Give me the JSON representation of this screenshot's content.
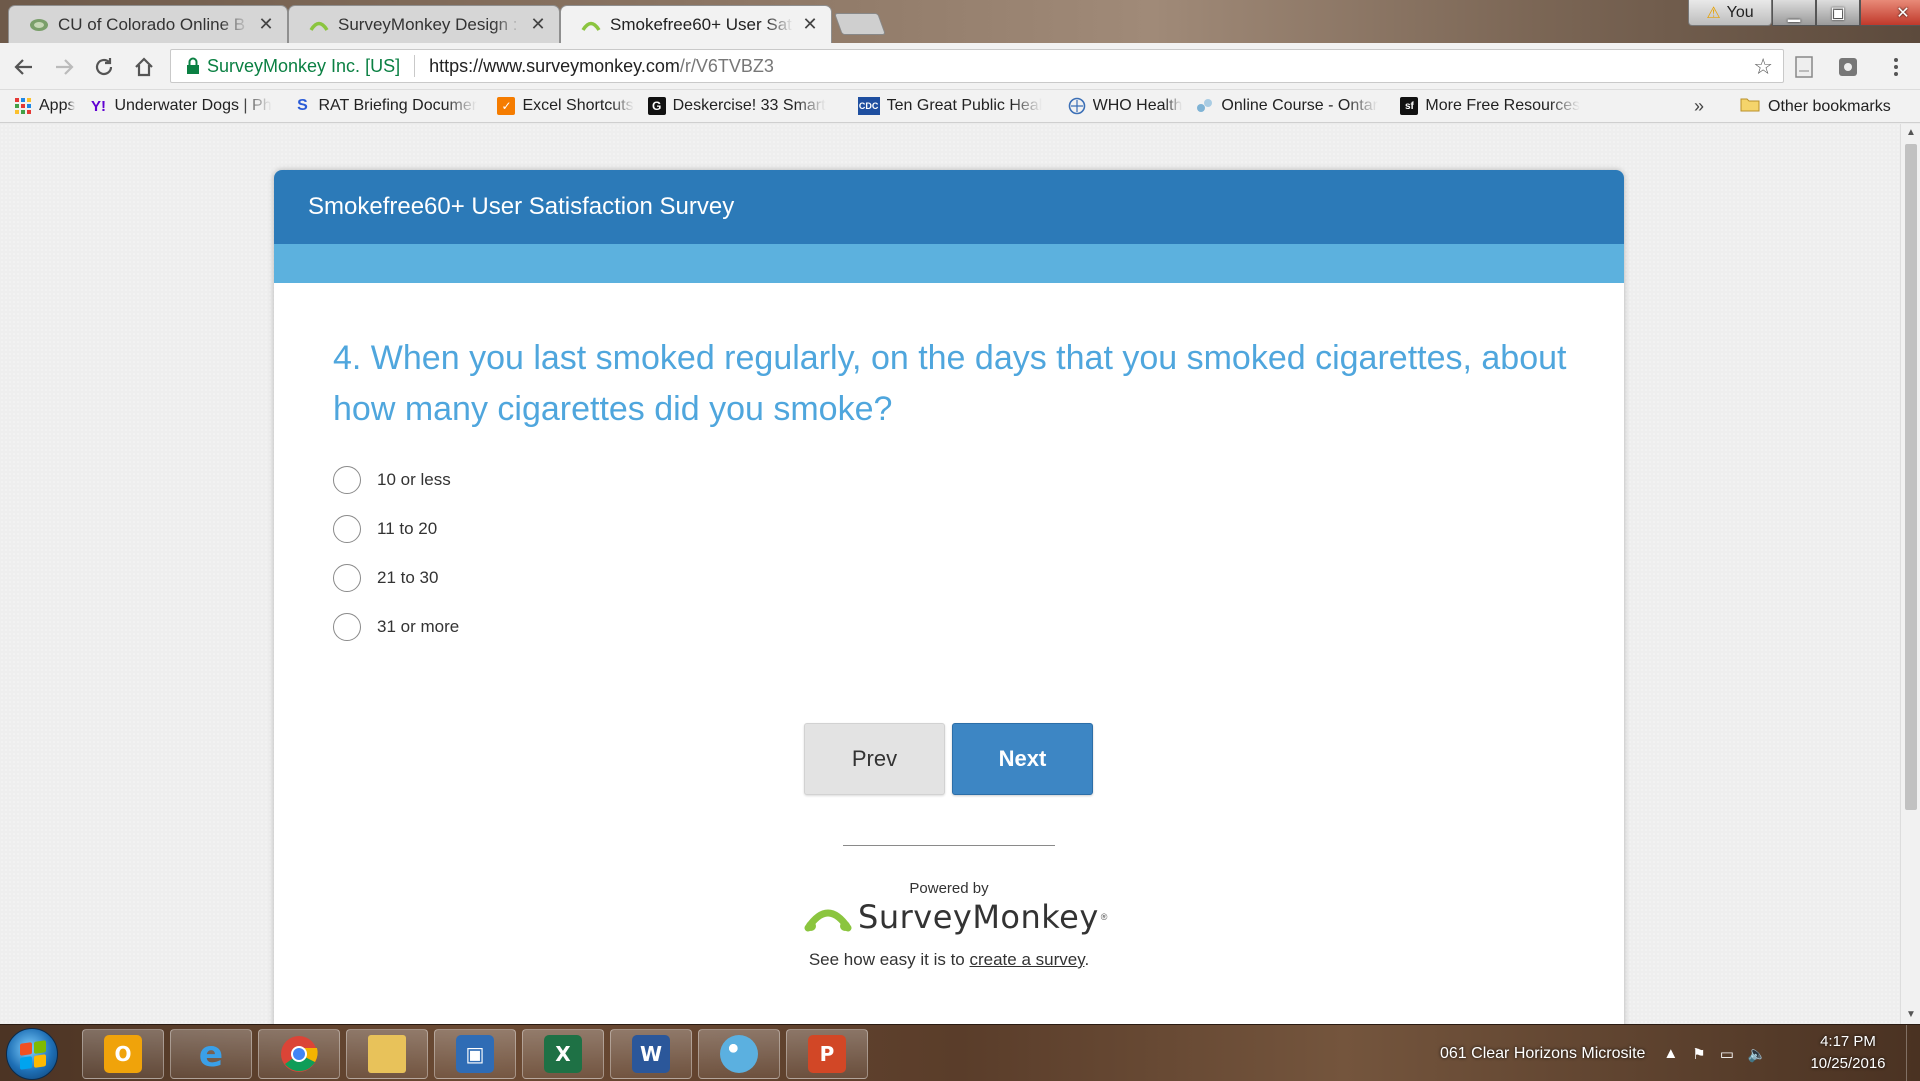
{
  "browser": {
    "tabs": [
      {
        "title": "CU of Colorado Online B",
        "close": "✕"
      },
      {
        "title": "SurveyMonkey Design : S",
        "close": "✕"
      },
      {
        "title": "Smokefree60+ User Satis",
        "close": "✕"
      }
    ],
    "profile_label": "You",
    "window_controls": {
      "minimize": "▁",
      "maximize": "▣",
      "close": "✕"
    },
    "address": {
      "secure_label": "SurveyMonkey Inc. [US]",
      "url_host": "https://www.surveymonkey.com",
      "url_path": "/r/V6TVBZ3"
    },
    "bookmarks": [
      {
        "label": "Apps",
        "icon": "apps-grid-icon"
      },
      {
        "label": "Underwater Dogs | Ph",
        "icon": "yahoo-icon"
      },
      {
        "label": "RAT Briefing Documer",
        "icon": "s-logo-icon"
      },
      {
        "label": "Excel Shortcuts",
        "icon": "orange-page-icon"
      },
      {
        "label": "Deskercise! 33 Smart",
        "icon": "g-logo-icon"
      },
      {
        "label": "Ten Great Public Heal",
        "icon": "cdc-icon"
      },
      {
        "label": "WHO Health",
        "icon": "who-icon"
      },
      {
        "label": "Online Course - Ontar",
        "icon": "course-icon"
      },
      {
        "label": "More Free Resources",
        "icon": "sf-icon"
      }
    ],
    "bookmarks_overflow": "»",
    "other_bookmarks": "Other bookmarks"
  },
  "survey": {
    "title": "Smokefree60+ User Satisfaction Survey",
    "question": "4. When you last smoked regularly, on the days that you smoked cigarettes, about how many cigarettes did you smoke?",
    "options": [
      "10 or less",
      "11 to 20",
      "21 to 30",
      "31 or more"
    ],
    "prev_label": "Prev",
    "next_label": "Next",
    "powered_by": "Powered by",
    "brand": "SurveyMonkey",
    "brand_mark": "®",
    "tagline_prefix": "See how easy it is to ",
    "tagline_link": "create a survey",
    "tagline_suffix": "."
  },
  "taskbar": {
    "apps": [
      "outlook",
      "internet-explorer",
      "chrome",
      "file-explorer",
      "remote-desktop",
      "excel",
      "word",
      "paint",
      "powerpoint"
    ],
    "tray_text": "061 Clear Horizons Microsite",
    "time": "4:17 PM",
    "date": "10/25/2016"
  },
  "colors": {
    "survey_header": "#2c7ab8",
    "survey_band": "#5cb1de",
    "question_text": "#4fa6dd",
    "next_button": "#3d86c4",
    "secure_green": "#0b8043",
    "brand_green": "#8bc53f"
  }
}
